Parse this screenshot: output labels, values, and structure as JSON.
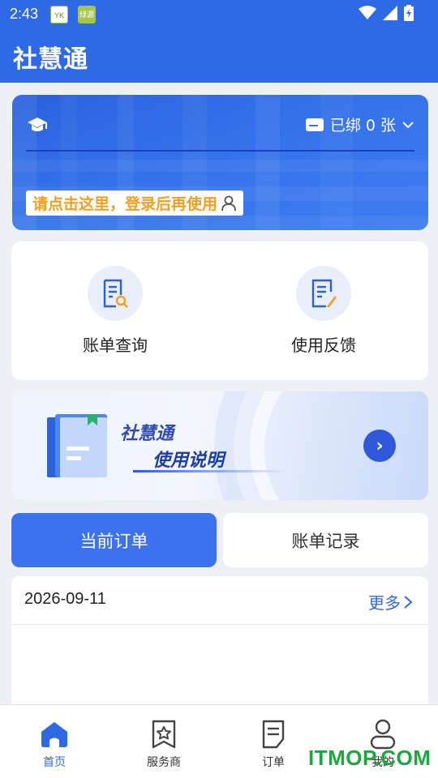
{
  "status_bar": {
    "time": "2:43",
    "app_icon_1_text": "YK",
    "app_icon_2_text": "绿源"
  },
  "app": {
    "title": "社慧通"
  },
  "card": {
    "bound_label": "已绑 0 张",
    "login_tip": "请点击这里，登录后再使用"
  },
  "quick_actions": [
    {
      "label": "账单查询",
      "icon": "bill-search-icon"
    },
    {
      "label": "使用反馈",
      "icon": "feedback-edit-icon"
    }
  ],
  "guide_banner": {
    "title": "社慧通",
    "subtitle": "使用说明"
  },
  "tabs": {
    "current": "当前订单",
    "bills": "账单记录"
  },
  "orders": {
    "date": "2026-09-11",
    "more": "更多"
  },
  "bottom_nav": [
    {
      "label": "首页",
      "icon": "home-icon",
      "active": true
    },
    {
      "label": "服务商",
      "icon": "star-badge-icon",
      "active": false
    },
    {
      "label": "订单",
      "icon": "document-icon",
      "active": false
    },
    {
      "label": "我的",
      "icon": "user-icon",
      "active": false
    }
  ],
  "watermark": "ITMOP.COM",
  "colors": {
    "primary": "#2f6ae6",
    "tab_active": "#3d72ee",
    "login_tip_text": "#f0a020",
    "watermark": "#19a93f"
  }
}
